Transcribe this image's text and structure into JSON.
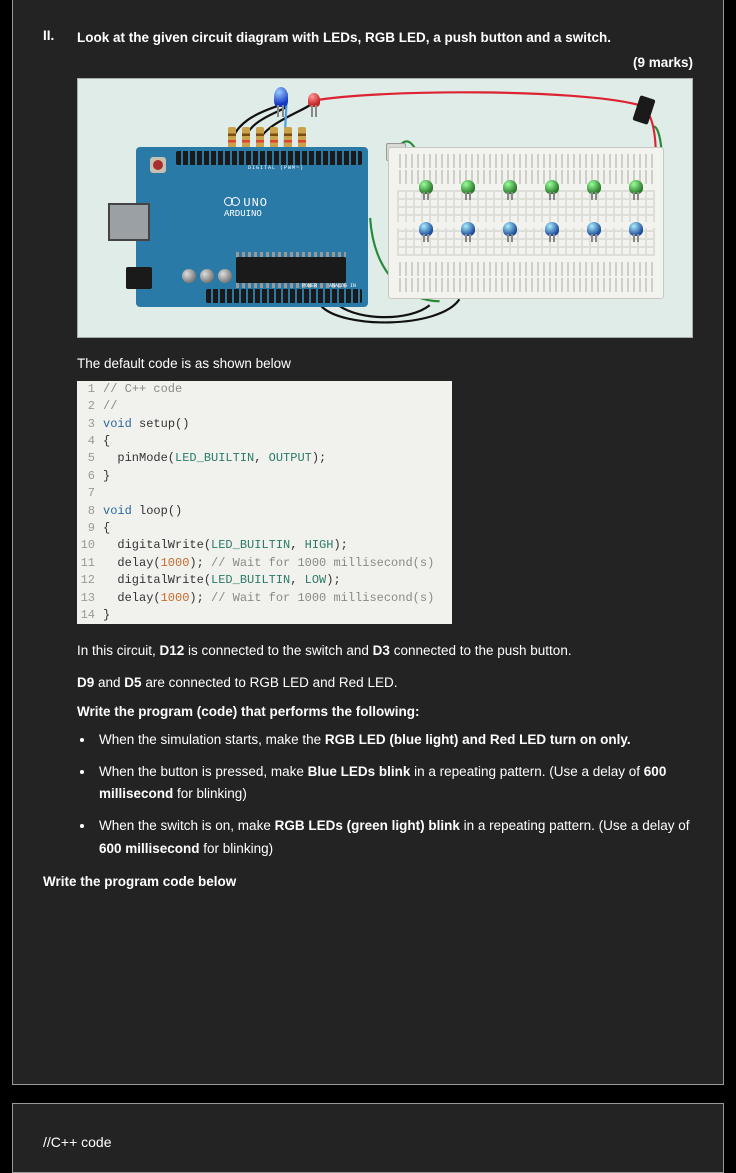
{
  "question": {
    "number": "II.",
    "prompt": "Look at the given circuit diagram with LEDs, RGB LED, a push button and a switch.",
    "marks": "(9 marks)"
  },
  "arduino": {
    "digital_label": "DIGITAL (PWM~)",
    "brand": "UNO",
    "sub": "ARDUINO",
    "power_label": "POWER",
    "analog_label": "ANALOG IN"
  },
  "caption_default": "The default code is as shown below",
  "code_lines": [
    {
      "n": "1",
      "html": "<span class='c-comment'>// C++ code</span>"
    },
    {
      "n": "2",
      "html": "<span class='c-comment'>//</span>"
    },
    {
      "n": "3",
      "html": "<span class='c-type'>void</span> <span class='c-func'>setup</span>()"
    },
    {
      "n": "4",
      "html": "{",
      "plain": "{"
    },
    {
      "n": "5",
      "html": "  pinMode(<span class='c-const'>LED_BUILTIN</span>, <span class='c-const'>OUTPUT</span>);"
    },
    {
      "n": "6",
      "html": "}"
    },
    {
      "n": "7",
      "html": ""
    },
    {
      "n": "8",
      "html": "<span class='c-type'>void</span> <span class='c-func'>loop</span>()"
    },
    {
      "n": "9",
      "html": "{"
    },
    {
      "n": "10",
      "html": "  digitalWrite(<span class='c-const'>LED_BUILTIN</span>, <span class='c-const'>HIGH</span>);"
    },
    {
      "n": "11",
      "html": "  delay(<span class='c-orange'>1000</span>); <span class='c-comment'>// Wait for 1000 millisecond(s)</span>"
    },
    {
      "n": "12",
      "html": "  digitalWrite(<span class='c-const'>LED_BUILTIN</span>, <span class='c-const'>LOW</span>);"
    },
    {
      "n": "13",
      "html": "  delay(<span class='c-orange'>1000</span>); <span class='c-comment'>// Wait for 1000 millisecond(s)</span>"
    },
    {
      "n": "14",
      "html": "}"
    }
  ],
  "body": {
    "p1_pre": "In this circuit, ",
    "p1_b1": "D12",
    "p1_mid1": " is connected to the switch and ",
    "p1_b2": "D3",
    "p1_post": " connected to the push button.",
    "p2_b1": "D9",
    "p2_mid": " and ",
    "p2_b2": "D5",
    "p2_post": " are connected to RGB LED and Red LED.",
    "instr": "Write the program (code) that performs the following:"
  },
  "tasks": [
    {
      "pre": "When the simulation starts, make the ",
      "b": "RGB LED (blue light) and Red LED turn on only.",
      "post": ""
    },
    {
      "pre": "When the button is pressed, make ",
      "b": "Blue LEDs blink",
      "mid": " in a repeating pattern. (Use a delay of ",
      "b2": "600 millisecond",
      "post": " for blinking)"
    },
    {
      "pre": "When the switch is on, make ",
      "b": "RGB LEDs (green light) blink",
      "mid": " in a repeating pattern. (Use a delay of ",
      "b2": "600 millisecond",
      "post": " for blinking)"
    }
  ],
  "answer_head": "Write the program code below",
  "answer_start": "//C++ code"
}
